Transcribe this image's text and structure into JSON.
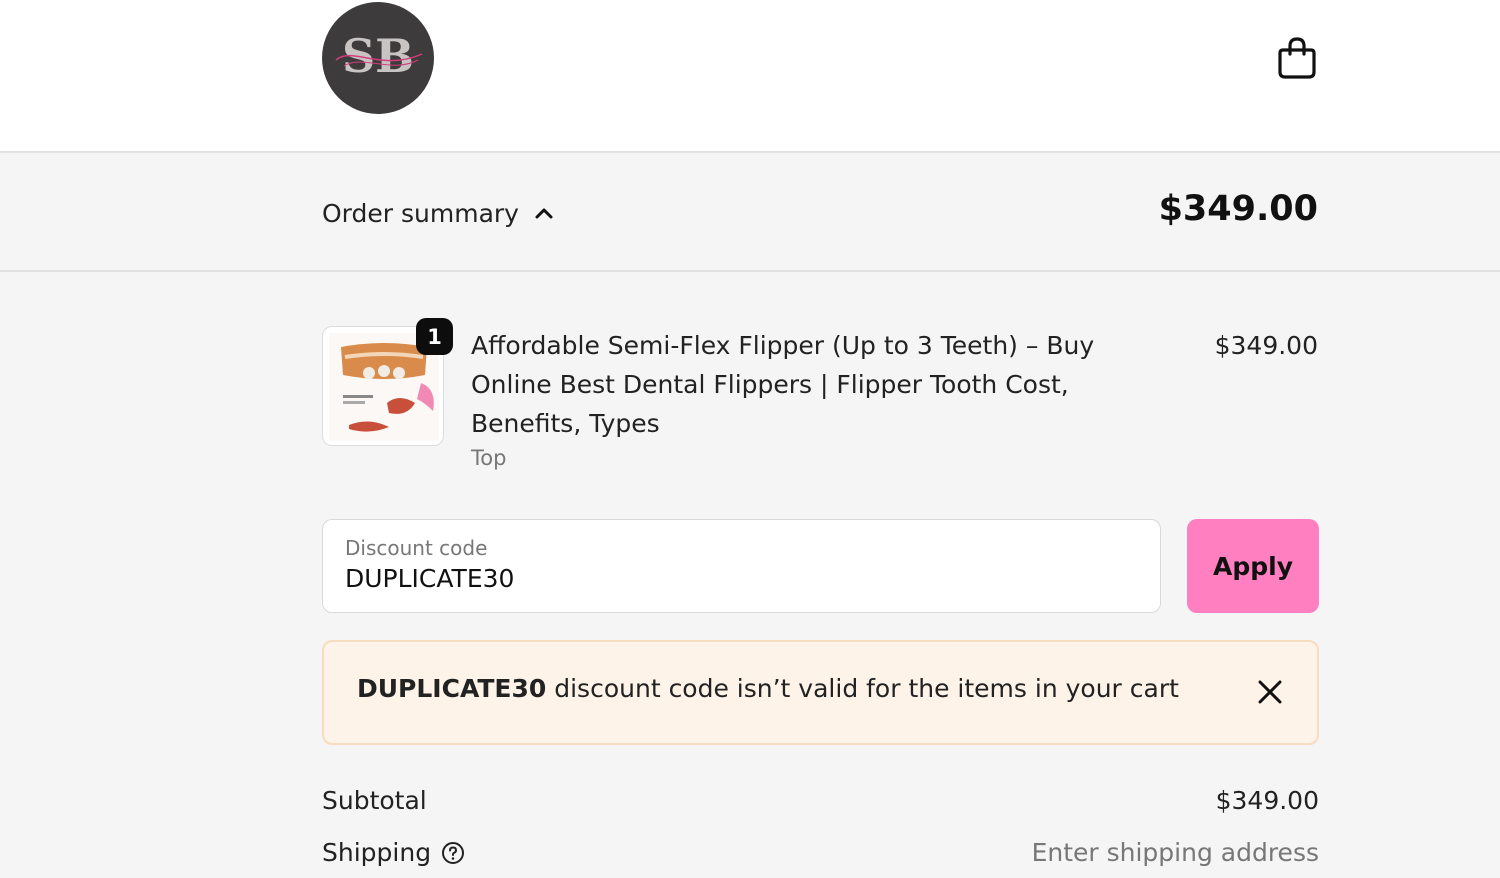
{
  "header": {
    "logo_text": "SB",
    "cart_icon": "shopping-bag-icon"
  },
  "summary": {
    "toggle_label": "Order summary",
    "toggle_icon": "chevron-up-icon",
    "total": "$349.00"
  },
  "product": {
    "quantity": "1",
    "title": "Affordable Semi-Flex Flipper (Up to 3 Teeth) – Buy Online Best Dental Flippers | Flipper Tooth Cost, Benefits, Types",
    "variant": "Top",
    "price": "$349.00"
  },
  "discount": {
    "label": "Discount code",
    "value": "DUPLICATE30",
    "apply_label": "Apply"
  },
  "error": {
    "code": "DUPLICATE30",
    "message": " discount code isn’t valid for the items in your cart",
    "close_icon": "close-icon"
  },
  "totals": {
    "subtotal_label": "Subtotal",
    "subtotal_value": "$349.00",
    "shipping_label": "Shipping",
    "shipping_value": "Enter shipping address"
  },
  "colors": {
    "accent": "#ff7fc0",
    "error_bg": "#fdf3e8",
    "error_border": "#f8dcc0",
    "logo_bg": "#3d3b3b"
  }
}
